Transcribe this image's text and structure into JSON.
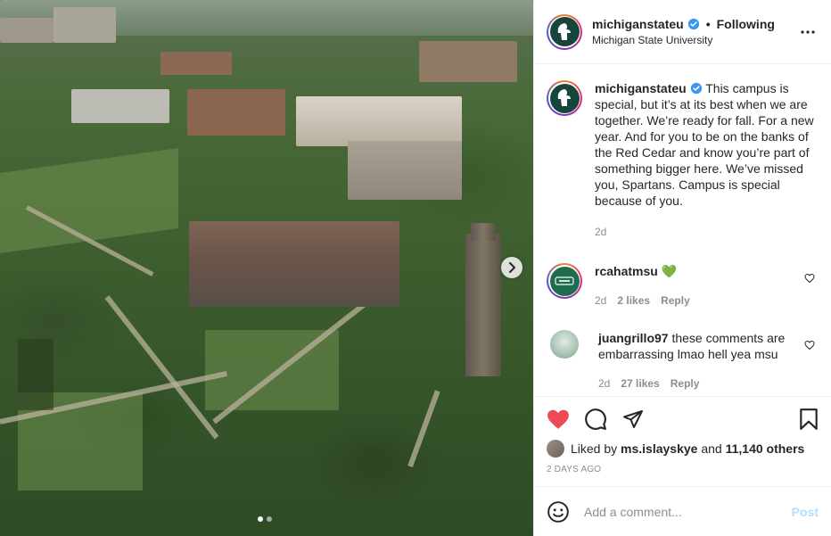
{
  "post": {
    "username": "michiganstateu",
    "following_label": "Following",
    "bullet": "•",
    "location": "Michigan State University",
    "verified_icon": "verified-badge-icon",
    "more_icon": "more-options-icon",
    "brand_color": "#18453b"
  },
  "caption": {
    "username": "michiganstateu",
    "text": "This campus is special, but it’s at its best when we are together. We’re ready for fall. For a new year. And for you to be on the banks of the Red Cedar and know you’re part of something bigger here. We’ve missed you, Spartans. Campus is special because of you.",
    "time": "2d"
  },
  "comments": [
    {
      "username": "rcahatmsu",
      "text": "💚",
      "time": "2d",
      "likes": "2 likes",
      "reply": "Reply"
    },
    {
      "username": "juangrillo97",
      "text": "these comments are embarrassing lmao hell yea msu",
      "time": "2d",
      "likes": "27 likes",
      "reply": "Reply"
    }
  ],
  "actions": {
    "liked_by_prefix": "Liked by",
    "liked_by_user": "ms.islayskye",
    "and": "and",
    "others": "11,140 others",
    "posted_ago": "2 DAYS AGO",
    "like_color": "#ed4956"
  },
  "composer": {
    "placeholder": "Add a comment...",
    "post_label": "Post"
  },
  "carousel": {
    "current": 1,
    "total": 2
  }
}
